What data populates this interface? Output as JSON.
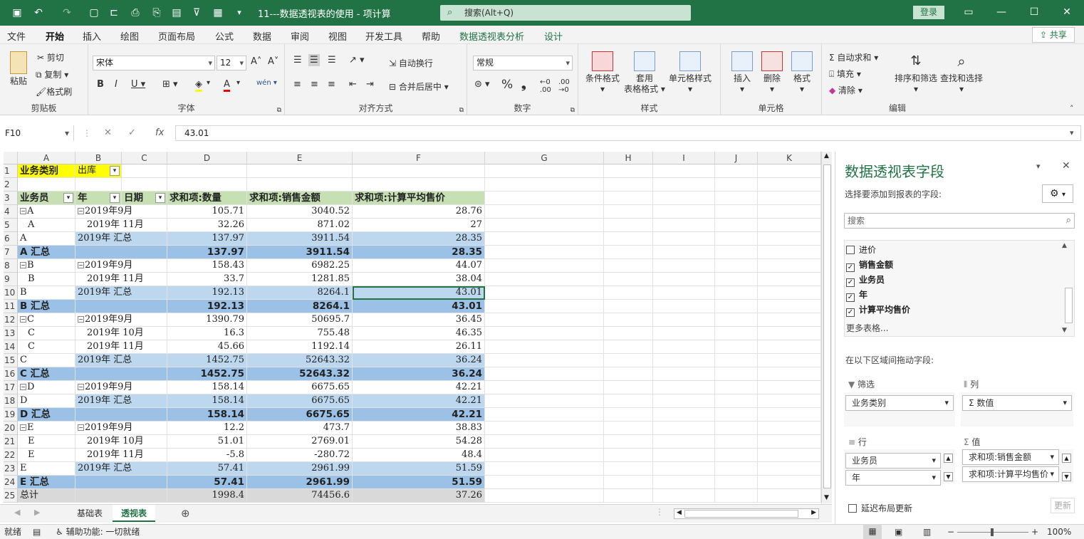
{
  "titlebar": {
    "title": "11---数据透视表的使用 - 项计算",
    "search_placeholder": "搜索(Alt+Q)",
    "login": "登录"
  },
  "menu": {
    "tabs": [
      "文件",
      "开始",
      "插入",
      "绘图",
      "页面布局",
      "公式",
      "数据",
      "审阅",
      "视图",
      "开发工具",
      "帮助",
      "数据透视表分析",
      "设计"
    ],
    "share": "共享"
  },
  "ribbon": {
    "clipboard": {
      "paste": "粘贴",
      "cut": "剪切",
      "copy": "复制",
      "format_painter": "格式刷",
      "label": "剪贴板"
    },
    "font": {
      "name": "宋体",
      "size": "12",
      "label": "字体"
    },
    "align": {
      "wrap": "自动换行",
      "merge": "合并后居中",
      "label": "对齐方式"
    },
    "number": {
      "format": "常规",
      "label": "数字"
    },
    "styles": {
      "conditional": "条件格式",
      "table_a": "套用",
      "table_b": "表格格式",
      "cell_styles": "单元格样式",
      "label": "样式"
    },
    "cells": {
      "insert": "插入",
      "delete": "删除",
      "format": "格式",
      "label": "单元格"
    },
    "edit": {
      "autosum": "自动求和",
      "fill": "填充",
      "clear": "清除",
      "sort": "排序和筛选",
      "find": "查找和选择",
      "label": "编辑"
    }
  },
  "formula": {
    "cell_ref": "F10",
    "fx": "fx",
    "value": "43.01"
  },
  "grid": {
    "columns": [
      "A",
      "B",
      "C",
      "D",
      "E",
      "F",
      "G",
      "H",
      "I",
      "J",
      "K"
    ],
    "filter_label": "业务类别",
    "filter_value": "出库",
    "headers": [
      "业务员",
      "年",
      "日期",
      "求和项:数量",
      "求和项:销售金额",
      "求和项:计算平均售价"
    ],
    "rows": [
      {
        "a": "A",
        "b": "2019年",
        "c": "9月",
        "d": "105.71",
        "e": "3040.52",
        "f": "28.76",
        "t": "data",
        "ea": true,
        "eb": true
      },
      {
        "a": "A",
        "b": "",
        "c": "2019年 11月",
        "d": "32.26",
        "e": "871.02",
        "f": "27",
        "t": "data"
      },
      {
        "a": "A",
        "b": "2019年 汇总",
        "c": "",
        "d": "137.97",
        "e": "3911.54",
        "f": "28.35",
        "t": "sub"
      },
      {
        "a": "A 汇总",
        "b": "",
        "c": "",
        "d": "137.97",
        "e": "3911.54",
        "f": "28.35",
        "t": "tot"
      },
      {
        "a": "B",
        "b": "2019年",
        "c": "9月",
        "d": "158.43",
        "e": "6982.25",
        "f": "44.07",
        "t": "data",
        "ea": true,
        "eb": true
      },
      {
        "a": "B",
        "b": "",
        "c": "2019年 11月",
        "d": "33.7",
        "e": "1281.85",
        "f": "38.04",
        "t": "data"
      },
      {
        "a": "B",
        "b": "2019年 汇总",
        "c": "",
        "d": "192.13",
        "e": "8264.1",
        "f": "43.01",
        "t": "sub"
      },
      {
        "a": "B 汇总",
        "b": "",
        "c": "",
        "d": "192.13",
        "e": "8264.1",
        "f": "43.01",
        "t": "tot"
      },
      {
        "a": "C",
        "b": "2019年",
        "c": "9月",
        "d": "1390.79",
        "e": "50695.7",
        "f": "36.45",
        "t": "data",
        "ea": true,
        "eb": true
      },
      {
        "a": "C",
        "b": "",
        "c": "2019年 10月",
        "d": "16.3",
        "e": "755.48",
        "f": "46.35",
        "t": "data"
      },
      {
        "a": "C",
        "b": "",
        "c": "2019年 11月",
        "d": "45.66",
        "e": "1192.14",
        "f": "26.11",
        "t": "data"
      },
      {
        "a": "C",
        "b": "2019年 汇总",
        "c": "",
        "d": "1452.75",
        "e": "52643.32",
        "f": "36.24",
        "t": "sub"
      },
      {
        "a": "C 汇总",
        "b": "",
        "c": "",
        "d": "1452.75",
        "e": "52643.32",
        "f": "36.24",
        "t": "tot"
      },
      {
        "a": "D",
        "b": "2019年",
        "c": "9月",
        "d": "158.14",
        "e": "6675.65",
        "f": "42.21",
        "t": "data",
        "ea": true,
        "eb": true
      },
      {
        "a": "D",
        "b": "2019年 汇总",
        "c": "",
        "d": "158.14",
        "e": "6675.65",
        "f": "42.21",
        "t": "sub"
      },
      {
        "a": "D 汇总",
        "b": "",
        "c": "",
        "d": "158.14",
        "e": "6675.65",
        "f": "42.21",
        "t": "tot"
      },
      {
        "a": "E",
        "b": "2019年",
        "c": "9月",
        "d": "12.2",
        "e": "473.7",
        "f": "38.83",
        "t": "data",
        "ea": true,
        "eb": true
      },
      {
        "a": "E",
        "b": "",
        "c": "2019年 10月",
        "d": "51.01",
        "e": "2769.01",
        "f": "54.28",
        "t": "data"
      },
      {
        "a": "E",
        "b": "",
        "c": "2019年 11月",
        "d": "-5.8",
        "e": "-280.72",
        "f": "48.4",
        "t": "data"
      },
      {
        "a": "E",
        "b": "2019年 汇总",
        "c": "",
        "d": "57.41",
        "e": "2961.99",
        "f": "51.59",
        "t": "sub"
      },
      {
        "a": "E 汇总",
        "b": "",
        "c": "",
        "d": "57.41",
        "e": "2961.99",
        "f": "51.59",
        "t": "tot"
      },
      {
        "a": "总计",
        "b": "",
        "c": "",
        "d": "1998.4",
        "e": "74456.6",
        "f": "37.26",
        "t": "grand"
      }
    ]
  },
  "sheets": {
    "tabs": [
      "基础表",
      "透视表"
    ],
    "active": "透视表"
  },
  "status": {
    "ready": "就绪",
    "accessibility": "辅助功能: 一切就绪",
    "zoom": "100%"
  },
  "pane": {
    "title": "数据透视表字段",
    "subtitle": "选择要添加到报表的字段:",
    "search_placeholder": "搜索",
    "fields": [
      {
        "name": "进价",
        "checked": false,
        "bold": false
      },
      {
        "name": "销售金额",
        "checked": true,
        "bold": true
      },
      {
        "name": "业务员",
        "checked": true,
        "bold": true
      },
      {
        "name": "年",
        "checked": true,
        "bold": true
      },
      {
        "name": "计算平均售价",
        "checked": true,
        "bold": true
      }
    ],
    "more_tables": "更多表格...",
    "drag_hint": "在以下区域间拖动字段:",
    "zone_filter": "筛选",
    "zone_columns": "列",
    "zone_rows": "行",
    "zone_values": "值",
    "filter_items": [
      "业务类别"
    ],
    "column_items": [
      "Σ 数值"
    ],
    "row_items": [
      "业务员",
      "年"
    ],
    "value_items": [
      "求和项:销售金额",
      "求和项:计算平均售价"
    ],
    "defer": "延迟布局更新",
    "update": "更新"
  }
}
